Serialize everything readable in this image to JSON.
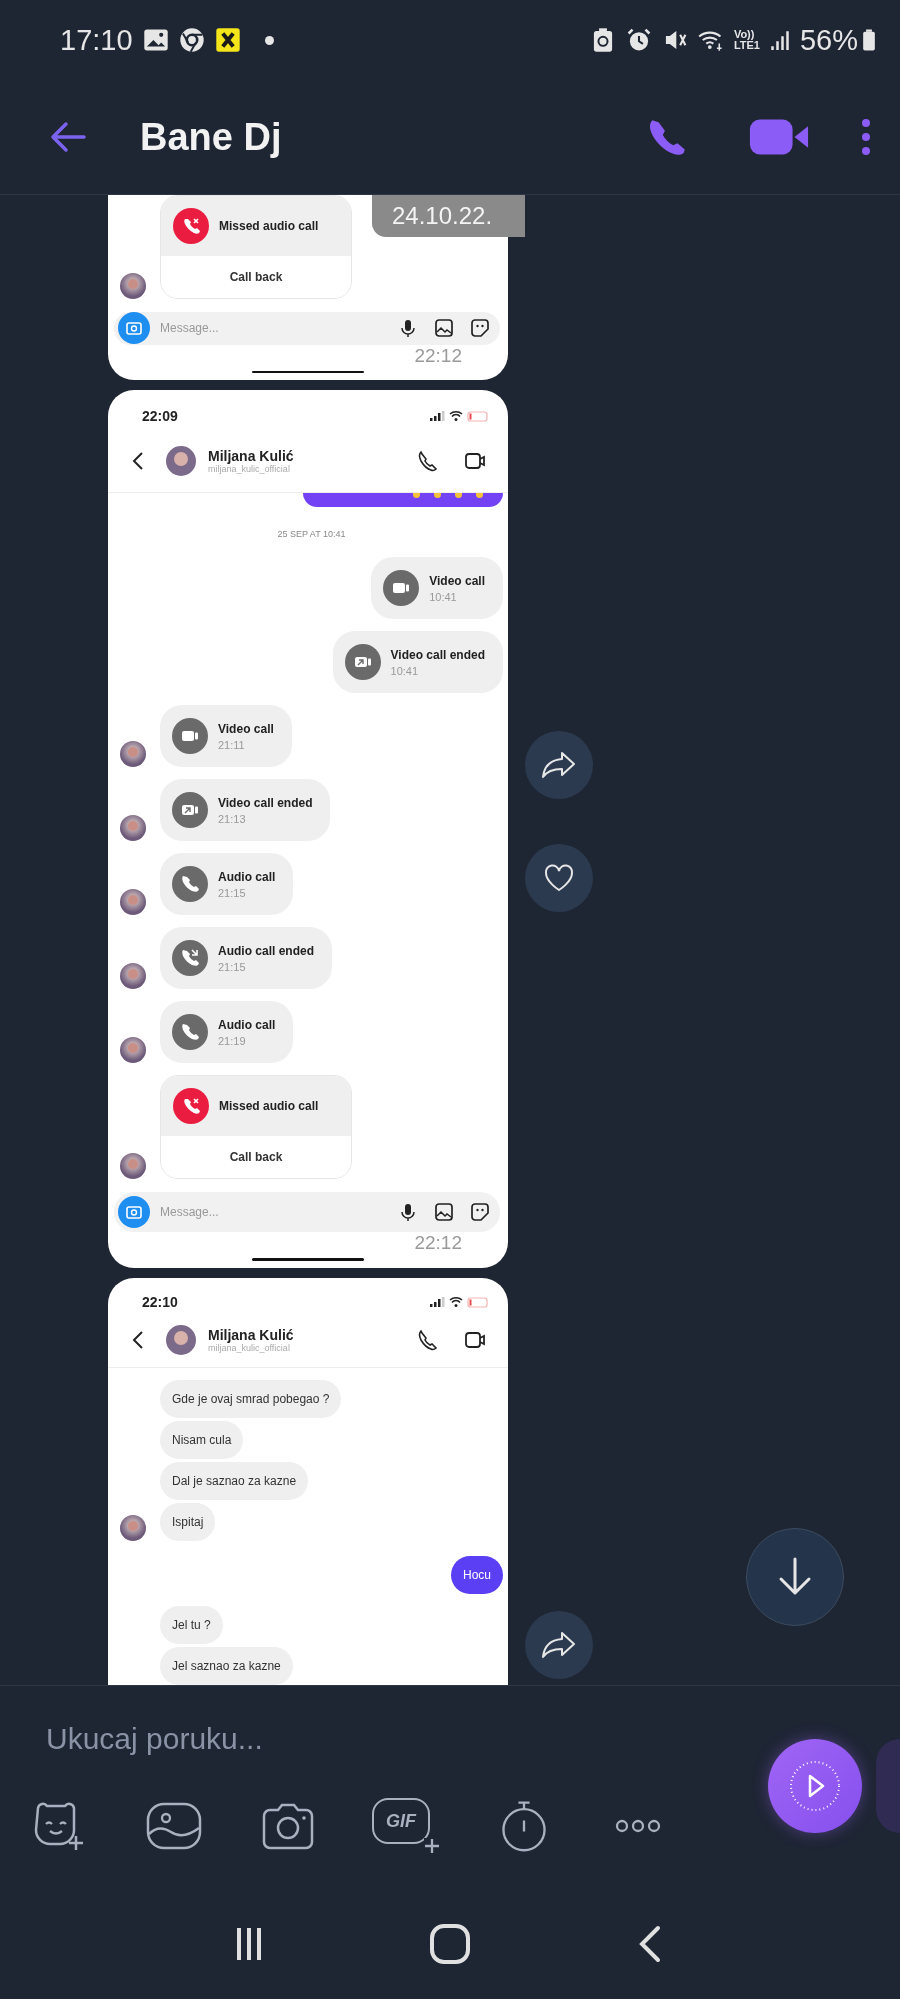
{
  "status_bar": {
    "time": "17:10",
    "network_label": [
      "Vo))",
      "LTE1"
    ],
    "battery": "56%"
  },
  "header": {
    "title": "Bane Dj"
  },
  "date_badge": "24.10.22.",
  "screenshots": [
    {
      "kind": "cropped_top",
      "messages": [
        {
          "kind": "missed",
          "title": "Missed audio call",
          "action": "Call back",
          "avatar": true
        }
      ],
      "composer": {
        "placeholder": "Message..."
      },
      "timestamp": "22:12"
    },
    {
      "kind": "full",
      "time": "22:09",
      "contact": {
        "name": "Miljana Kulić",
        "handle": "miljana_kulic_official"
      },
      "messages": [
        {
          "kind": "stub"
        },
        {
          "kind": "date",
          "label": "25 SEP AT 10:41"
        },
        {
          "kind": "video_call",
          "title": "Video call",
          "time": "10:41",
          "outgoing": true,
          "avatar": false
        },
        {
          "kind": "video_call_ended",
          "title": "Video call ended",
          "time": "10:41",
          "outgoing": true,
          "avatar": false
        },
        {
          "kind": "video_call",
          "title": "Video call",
          "time": "21:11",
          "outgoing": false,
          "avatar": true
        },
        {
          "kind": "video_call_ended",
          "title": "Video call ended",
          "time": "21:13",
          "outgoing": false,
          "avatar": true
        },
        {
          "kind": "audio_call",
          "title": "Audio call",
          "time": "21:15",
          "outgoing": false,
          "avatar": true
        },
        {
          "kind": "audio_call_ended",
          "title": "Audio call ended",
          "time": "21:15",
          "outgoing": false,
          "avatar": true
        },
        {
          "kind": "audio_call",
          "title": "Audio call",
          "time": "21:19",
          "outgoing": false,
          "avatar": true
        },
        {
          "kind": "missed",
          "title": "Missed audio call",
          "action": "Call back",
          "avatar": true
        }
      ],
      "composer": {
        "placeholder": "Message..."
      },
      "timestamp": "22:12"
    },
    {
      "kind": "cropped_bottom",
      "time": "22:10",
      "contact": {
        "name": "Miljana Kulić",
        "handle": "miljana_kulic_official"
      },
      "messages": [
        {
          "kind": "text",
          "text": "Gde je ovaj smrad pobegao ?",
          "outgoing": false,
          "avatar": false
        },
        {
          "kind": "text",
          "text": "Nisam cula",
          "outgoing": false,
          "avatar": false
        },
        {
          "kind": "text",
          "text": "Dal je saznao za kazne",
          "outgoing": false,
          "avatar": false
        },
        {
          "kind": "text",
          "text": "Ispitaj",
          "outgoing": false,
          "avatar": true
        },
        {
          "kind": "text",
          "text": "Hocu",
          "outgoing": true,
          "avatar": false
        },
        {
          "kind": "text",
          "text": "Jel tu ?",
          "outgoing": false,
          "avatar": false
        },
        {
          "kind": "text",
          "text": "Jel saznao za kazne",
          "outgoing": false,
          "avatar": false
        }
      ]
    }
  ],
  "composer": {
    "placeholder": "Ukucaj poruku..."
  },
  "toolbar": [
    {
      "kind": "sticker"
    },
    {
      "kind": "gallery"
    },
    {
      "kind": "camera"
    },
    {
      "kind": "gif",
      "label": "GIF"
    },
    {
      "kind": "timer"
    },
    {
      "kind": "more"
    }
  ]
}
